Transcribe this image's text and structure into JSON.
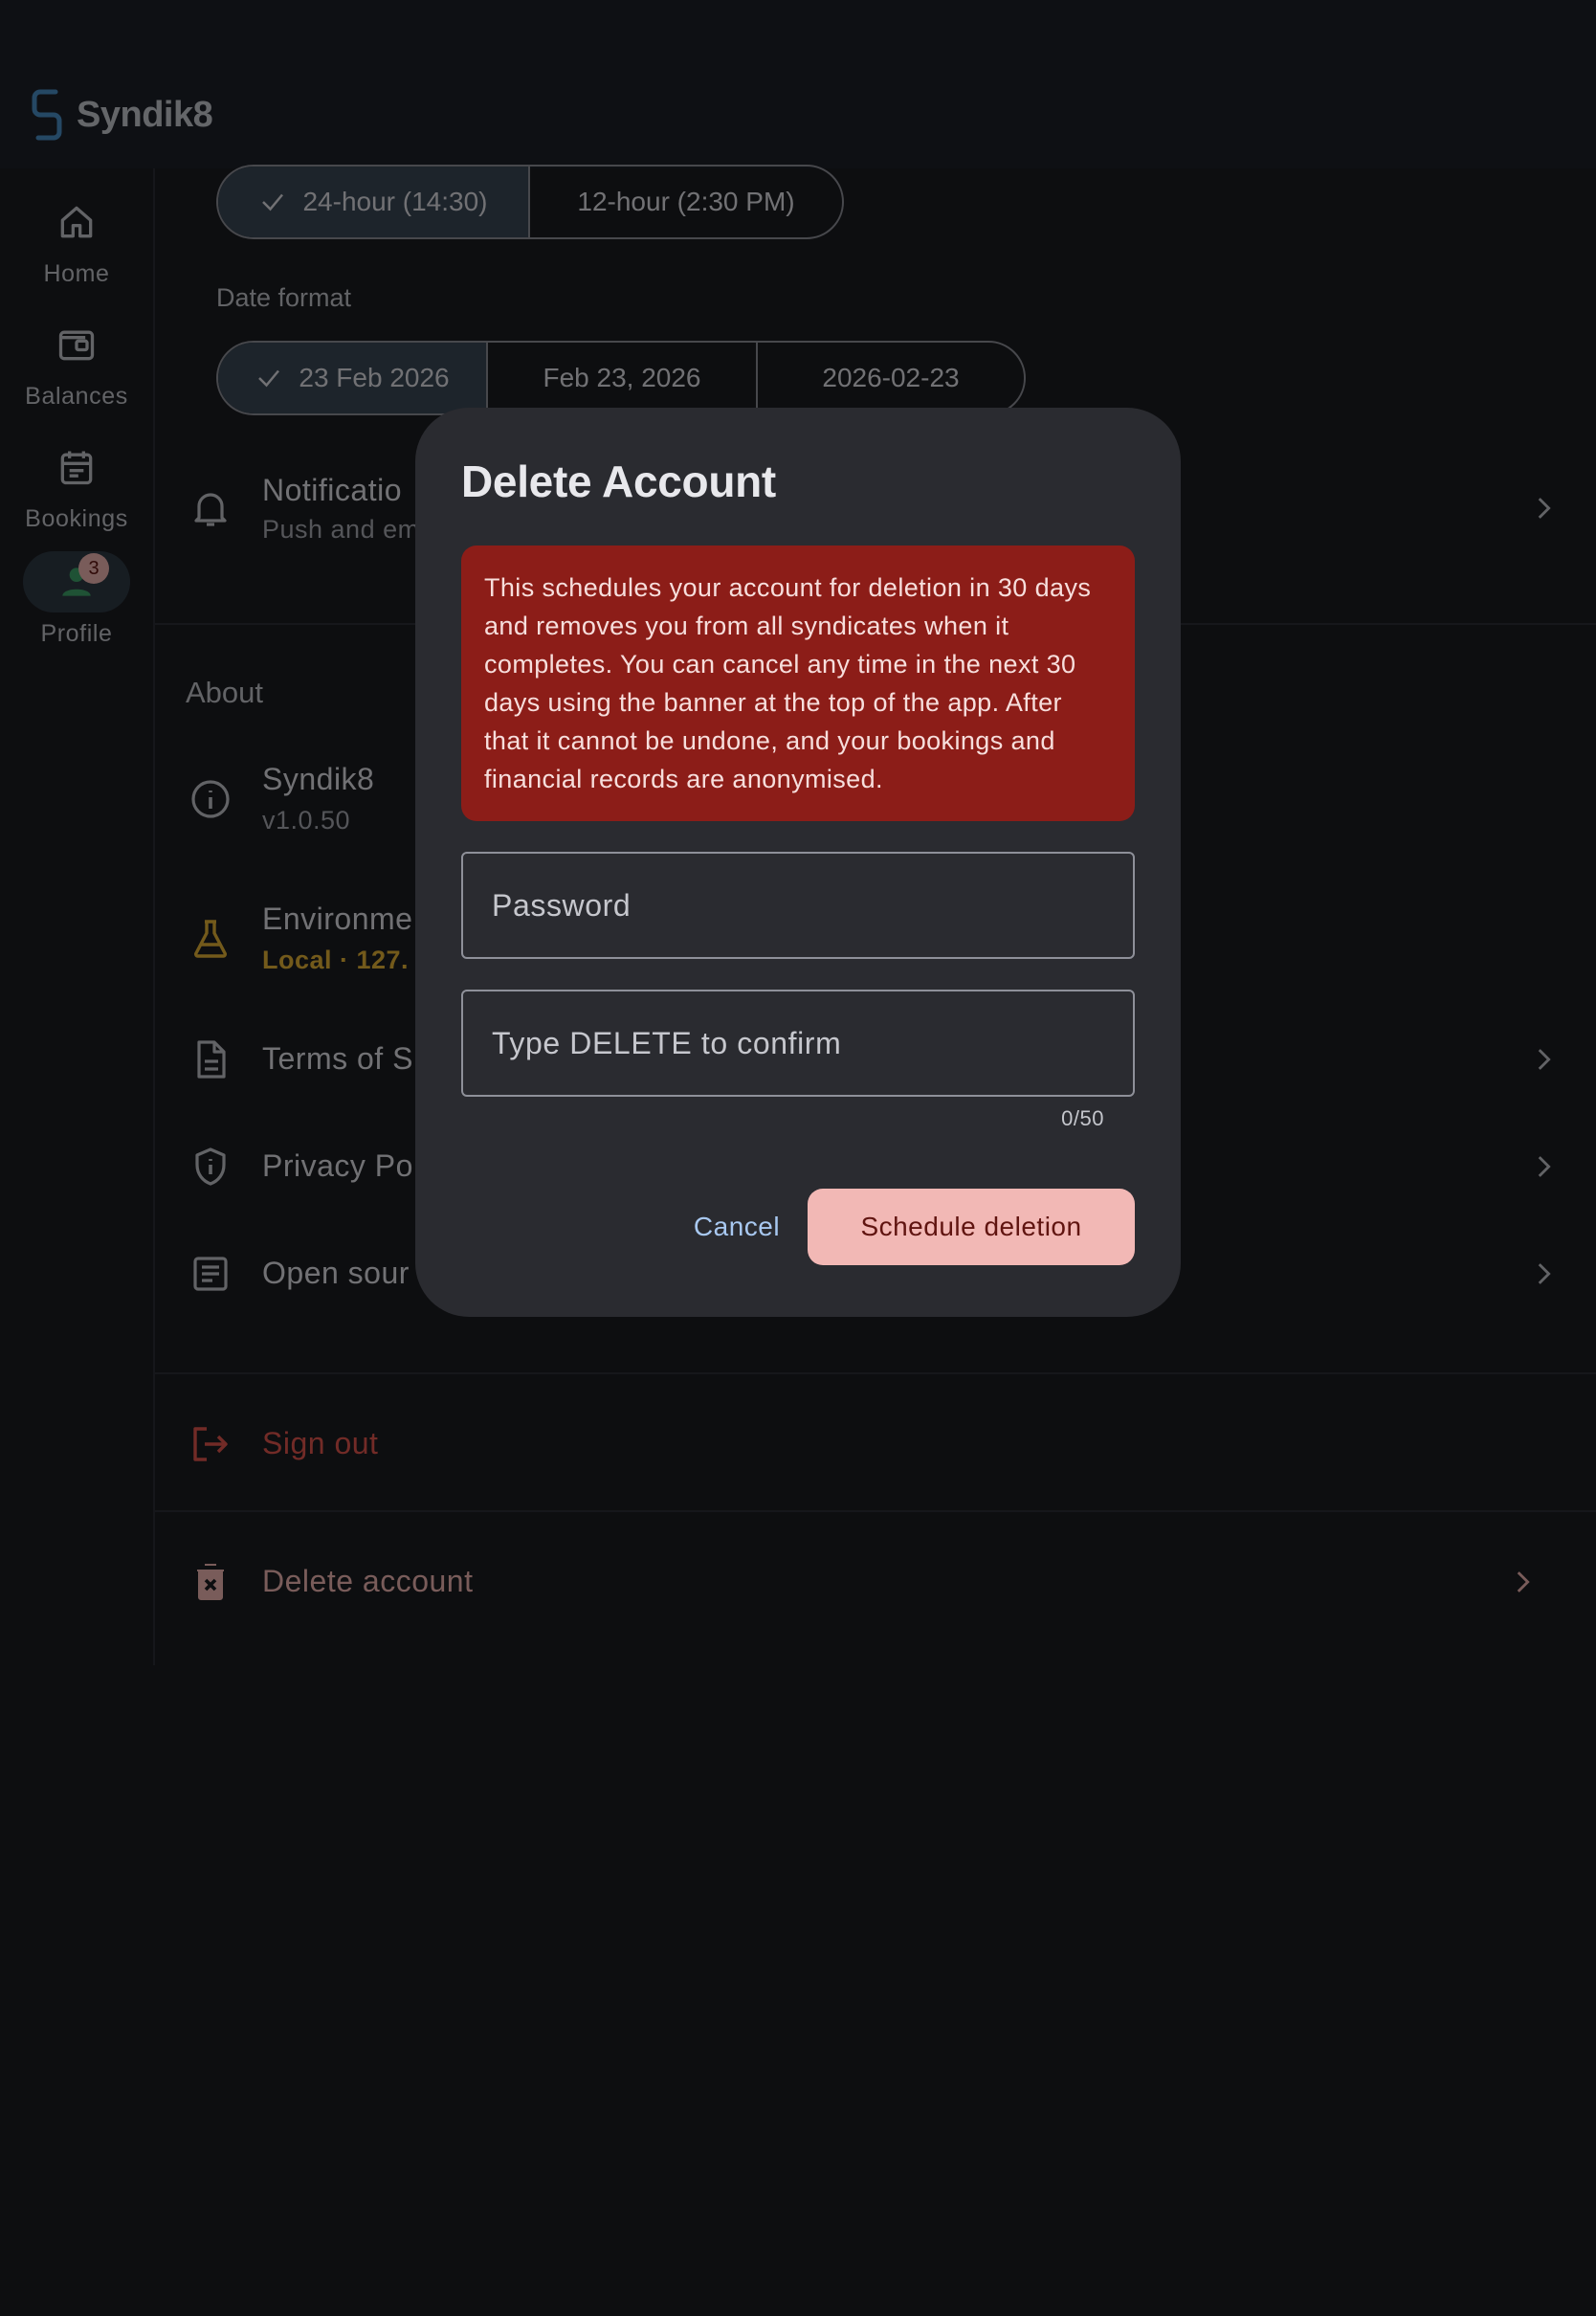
{
  "app": {
    "name": "Syndik8"
  },
  "nav": {
    "items": [
      {
        "label": "Home",
        "icon": "home-icon"
      },
      {
        "label": "Balances",
        "icon": "wallet-icon"
      },
      {
        "label": "Bookings",
        "icon": "calendar-icon"
      },
      {
        "label": "Profile",
        "icon": "person-icon",
        "badge": "3",
        "active": true
      }
    ]
  },
  "settings": {
    "time_format": {
      "options": [
        "24-hour (14:30)",
        "12-hour (2:30 PM)"
      ],
      "selected": "24-hour (14:30)"
    },
    "date_format": {
      "label": "Date format",
      "options": [
        "23 Feb 2026",
        "Feb 23, 2026",
        "2026-02-23"
      ],
      "selected": "23 Feb 2026"
    },
    "notifications": {
      "title": "Notificatio",
      "subtitle": "Push and em"
    }
  },
  "about": {
    "title": "About",
    "version_row": {
      "title": "Syndik8",
      "subtitle": "v1.0.50"
    },
    "environment_row": {
      "title": "Environme",
      "subtitle": "Local · 127."
    },
    "terms_row": {
      "title": "Terms of S"
    },
    "privacy_row": {
      "title": "Privacy Po"
    },
    "open_source_row": {
      "title": "Open sour"
    }
  },
  "account": {
    "sign_out": "Sign out",
    "delete_account": "Delete account"
  },
  "dialog": {
    "title": "Delete Account",
    "warning": "This schedules your account for deletion in 30 days and removes you from all syndicates when it completes. You can cancel any time in the next 30 days using the banner at the top of the app. After that it cannot be undone, and your bookings and financial records are anonymised.",
    "password_placeholder": "Password",
    "confirm_placeholder": "Type DELETE to confirm",
    "counter": "0/50",
    "cancel_label": "Cancel",
    "confirm_label": "Schedule deletion"
  },
  "colors": {
    "background": "#1b1c21",
    "dialog_surface": "#2a2b30",
    "error_container": "#8c1d18",
    "error_button": "#f2b8b5",
    "cancel_text": "#a8c8f0",
    "brand_blue": "#4a90c9",
    "sign_out_red": "#e5574e",
    "environment_yellow": "#e6b437"
  }
}
